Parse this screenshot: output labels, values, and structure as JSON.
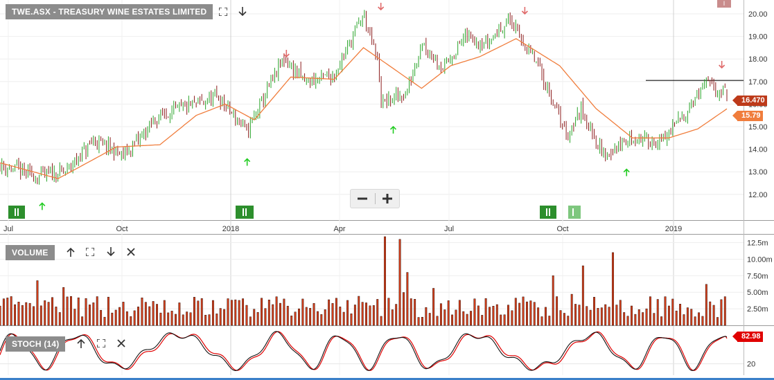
{
  "panels": {
    "price_label": "TWE.ASX - TREASURY WINE ESTATES LIMITED",
    "volume_label": "VOLUME",
    "stoch_label": "STOCH (14)"
  },
  "tags": {
    "close": "16.470",
    "ma": "15.79",
    "stoch": "82.98"
  },
  "corner_badge": "I",
  "colors": {
    "up": "#27a327",
    "down": "#8b1a1a",
    "ma": "#f07d3c",
    "volume": "#d9401c",
    "stoch_k": "#111111",
    "stoch_d": "#e00000",
    "up_arrow": "#22cc22",
    "down_arrow": "#e06a6a"
  },
  "chart_data": [
    {
      "type": "candlestick",
      "title": "TWE.ASX - TREASURY WINE ESTATES LIMITED",
      "x_ticks": [
        "Jul",
        "Oct",
        "2018",
        "Apr",
        "Jul",
        "Oct",
        "2019"
      ],
      "y_ticks": [
        "12.00",
        "13.00",
        "14.00",
        "15.00",
        "16.00",
        "17.00",
        "18.00",
        "19.00",
        "20.00"
      ],
      "ylim": [
        11.5,
        20.5
      ],
      "price_path": [
        {
          "t": 0,
          "v": 13.3
        },
        {
          "t": 0.05,
          "v": 12.8
        },
        {
          "t": 0.09,
          "v": 13.0
        },
        {
          "t": 0.13,
          "v": 14.4
        },
        {
          "t": 0.17,
          "v": 13.7
        },
        {
          "t": 0.22,
          "v": 15.5
        },
        {
          "t": 0.26,
          "v": 15.9
        },
        {
          "t": 0.3,
          "v": 16.3
        },
        {
          "t": 0.34,
          "v": 14.8
        },
        {
          "t": 0.39,
          "v": 18.0
        },
        {
          "t": 0.42,
          "v": 17.0
        },
        {
          "t": 0.46,
          "v": 17.3
        },
        {
          "t": 0.5,
          "v": 20.0
        },
        {
          "t": 0.52,
          "v": 17.8
        },
        {
          "t": 0.525,
          "v": 16.0
        },
        {
          "t": 0.56,
          "v": 16.5
        },
        {
          "t": 0.58,
          "v": 18.8
        },
        {
          "t": 0.61,
          "v": 17.6
        },
        {
          "t": 0.64,
          "v": 19.0
        },
        {
          "t": 0.67,
          "v": 18.7
        },
        {
          "t": 0.7,
          "v": 19.8
        },
        {
          "t": 0.74,
          "v": 17.7
        },
        {
          "t": 0.78,
          "v": 14.6
        },
        {
          "t": 0.8,
          "v": 15.8
        },
        {
          "t": 0.83,
          "v": 13.7
        },
        {
          "t": 0.87,
          "v": 14.5
        },
        {
          "t": 0.91,
          "v": 14.3
        },
        {
          "t": 0.94,
          "v": 15.5
        },
        {
          "t": 0.97,
          "v": 16.9
        },
        {
          "t": 1.0,
          "v": 16.47
        }
      ],
      "ma_path": [
        {
          "t": 0,
          "v": 13.4
        },
        {
          "t": 0.08,
          "v": 12.7
        },
        {
          "t": 0.16,
          "v": 14.1
        },
        {
          "t": 0.22,
          "v": 14.2
        },
        {
          "t": 0.27,
          "v": 15.5
        },
        {
          "t": 0.31,
          "v": 16.0
        },
        {
          "t": 0.35,
          "v": 15.3
        },
        {
          "t": 0.4,
          "v": 17.2
        },
        {
          "t": 0.46,
          "v": 17.1
        },
        {
          "t": 0.5,
          "v": 18.5
        },
        {
          "t": 0.54,
          "v": 17.6
        },
        {
          "t": 0.58,
          "v": 16.7
        },
        {
          "t": 0.62,
          "v": 17.7
        },
        {
          "t": 0.66,
          "v": 18.1
        },
        {
          "t": 0.71,
          "v": 18.9
        },
        {
          "t": 0.77,
          "v": 17.7
        },
        {
          "t": 0.82,
          "v": 15.8
        },
        {
          "t": 0.87,
          "v": 14.5
        },
        {
          "t": 0.92,
          "v": 14.5
        },
        {
          "t": 0.96,
          "v": 14.9
        },
        {
          "t": 1.0,
          "v": 15.79
        }
      ],
      "resistance_level": 17.05,
      "up_arrows_t": [
        0.058,
        0.34,
        0.541,
        0.862
      ],
      "down_arrows_t": [
        0.394,
        0.524,
        0.722,
        0.993
      ]
    },
    {
      "type": "bar",
      "title": "VOLUME",
      "y_ticks": [
        "2.50m",
        "5.00m",
        "7.50m",
        "10.00m",
        "12.5m"
      ],
      "ylim": [
        0,
        13500000
      ]
    },
    {
      "type": "line",
      "title": "STOCH (14)",
      "y_ticks": [
        "20"
      ],
      "ylim": [
        0,
        100
      ],
      "last_value": 82.98
    }
  ]
}
